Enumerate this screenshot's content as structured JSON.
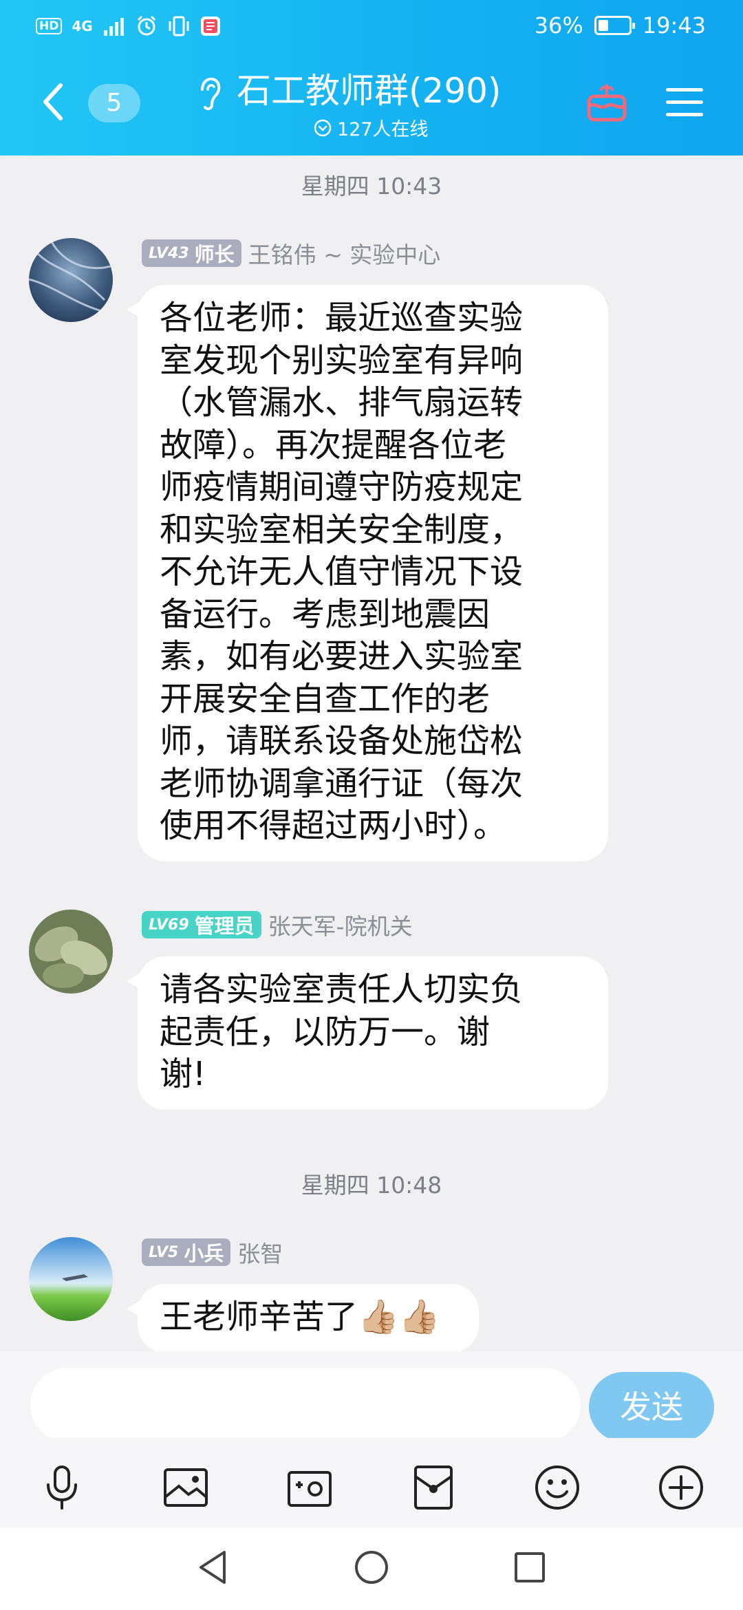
{
  "status_bar": {
    "hd": "HD",
    "network": "4G",
    "battery": "36%",
    "time": "19:43"
  },
  "header": {
    "unread_count": "5",
    "group_title": "石工教师群(290)",
    "online_text": "127人在线"
  },
  "messages": [
    {
      "timestamp": "星期四 10:43",
      "level": "LV43",
      "role": "师长",
      "sender": "王铭伟 ~ 实验中心",
      "lines": [
        "各位老师：最近巡查实验",
        "室发现个别实验室有异响",
        "（水管漏水、排气扇运转",
        "故障）。再次提醒各位老",
        "师疫情期间遵守防疫规定",
        "和实验室相关安全制度，",
        "不允许无人值守情况下设",
        "备运行。考虑到地震因",
        "素，如有必要进入实验室",
        "开展安全自查工作的老",
        "师，请联系设备处施岱松",
        "老师协调拿通行证（每次",
        "使用不得超过两小时）。"
      ]
    },
    {
      "level": "LV69",
      "role": "管理员",
      "sender": "张天军-院机关",
      "lines": [
        "请各实验室责任人切实负",
        "起责任，以防万一。谢",
        "谢!"
      ]
    },
    {
      "timestamp": "星期四 10:48",
      "level": "LV5",
      "role": "小兵",
      "sender": "张智",
      "lines": [
        "王老师辛苦了👍🏼👍🏼"
      ]
    }
  ],
  "input": {
    "placeholder": "",
    "send_label": "发送"
  },
  "toolbar": [
    "microphone-icon",
    "image-icon",
    "camera-icon",
    "red-packet-icon",
    "emoji-icon",
    "plus-icon"
  ],
  "colors": {
    "header_blue": "#14b1f2",
    "send_button": "#7fc8f1",
    "lv_gray": "#a9adbd",
    "lv_teal": "#47d3c6"
  }
}
